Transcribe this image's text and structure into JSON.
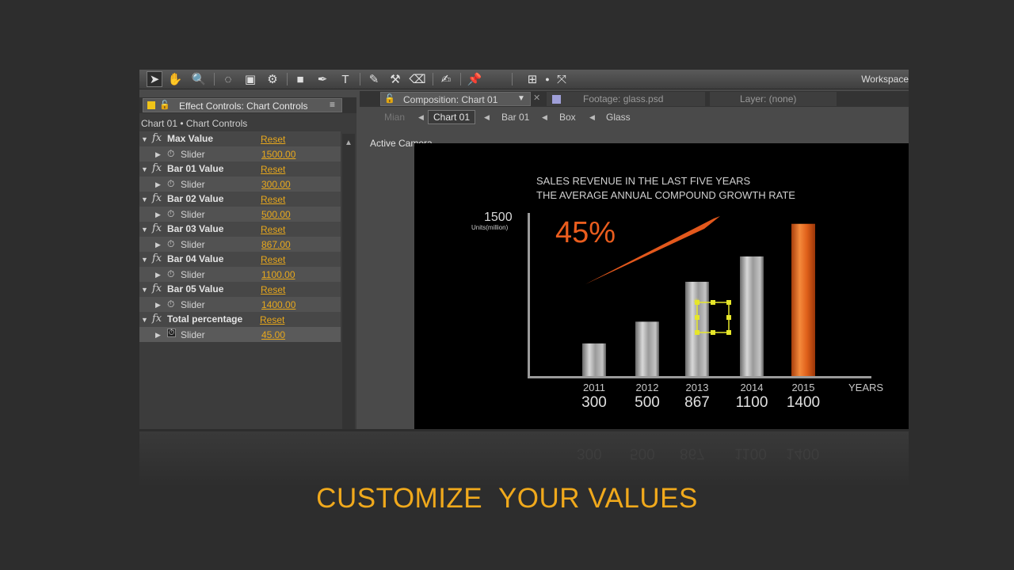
{
  "toolbar": {
    "icons": [
      "selection-arrow-icon",
      "hand-icon",
      "zoom-icon",
      "rotate-icon",
      "camera-icon",
      "pan-behind-icon",
      "rectangle-icon",
      "pen-icon",
      "type-icon",
      "brush-icon",
      "clone-stamp-icon",
      "eraser-icon",
      "roto-brush-icon",
      "puppet-pin-icon",
      "snap-icon",
      "dot-icon",
      "axis-icon"
    ],
    "glyphs": [
      "➤",
      "✋",
      "🔍",
      "◌",
      "▣",
      "⚙",
      "■",
      "✒",
      "T",
      "✎",
      "⚒",
      "⌫",
      "✍",
      "📌",
      "⊞",
      "●",
      "⤧"
    ],
    "workspace_label": "Workspace"
  },
  "effect_panel": {
    "tab_title": "Effect Controls: Chart Controls",
    "subtitle": "Chart 01 • Chart Controls",
    "effects": [
      {
        "name": "Max Value",
        "reset": "Reset",
        "slider_label": "Slider",
        "value": "1500.00"
      },
      {
        "name": "Bar 01 Value",
        "reset": "Reset",
        "slider_label": "Slider",
        "value": "300.00"
      },
      {
        "name": "Bar 02 Value",
        "reset": "Reset",
        "slider_label": "Slider",
        "value": "500.00"
      },
      {
        "name": "Bar 03 Value",
        "reset": "Reset",
        "slider_label": "Slider",
        "value": "867.00"
      },
      {
        "name": "Bar 04 Value",
        "reset": "Reset",
        "slider_label": "Slider",
        "value": "1100.00"
      },
      {
        "name": "Bar 05 Value",
        "reset": "Reset",
        "slider_label": "Slider",
        "value": "1400.00"
      },
      {
        "name": "Total percentage",
        "reset": "Reset",
        "slider_label": "Slider",
        "value": "45.00"
      }
    ]
  },
  "comp_panel": {
    "tabs": {
      "composition": "Composition: Chart 01",
      "footage": "Footage: glass.psd",
      "layer": "Layer: (none)"
    },
    "breadcrumbs": [
      "Mian",
      "Chart 01",
      "Bar 01",
      "Box",
      "Glass"
    ],
    "viewer_label": "Active Camera"
  },
  "chart_data": {
    "type": "bar",
    "title": "SALES REVENUE IN THE LAST FIVE YEARS",
    "subtitle": "THE AVERAGE ANNUAL COMPOUND GROWTH RATE",
    "categories": [
      "2011",
      "2012",
      "2013",
      "2014",
      "2015"
    ],
    "values": [
      300,
      500,
      867,
      1100,
      1400
    ],
    "value_labels": [
      "300",
      "500",
      "867",
      "1100",
      "1400"
    ],
    "ymax_label": "1500",
    "ylabel": "Units(million)",
    "xlabel": "YEARS",
    "growth_label": "45%",
    "ylim": [
      0,
      1500
    ],
    "highlight_index": 4,
    "colors": {
      "bar": "#a8a8a8",
      "highlight": "#e8661a",
      "growth": "#e05a1a"
    }
  },
  "tagline": "CUSTOMIZE  YOUR VALUES"
}
